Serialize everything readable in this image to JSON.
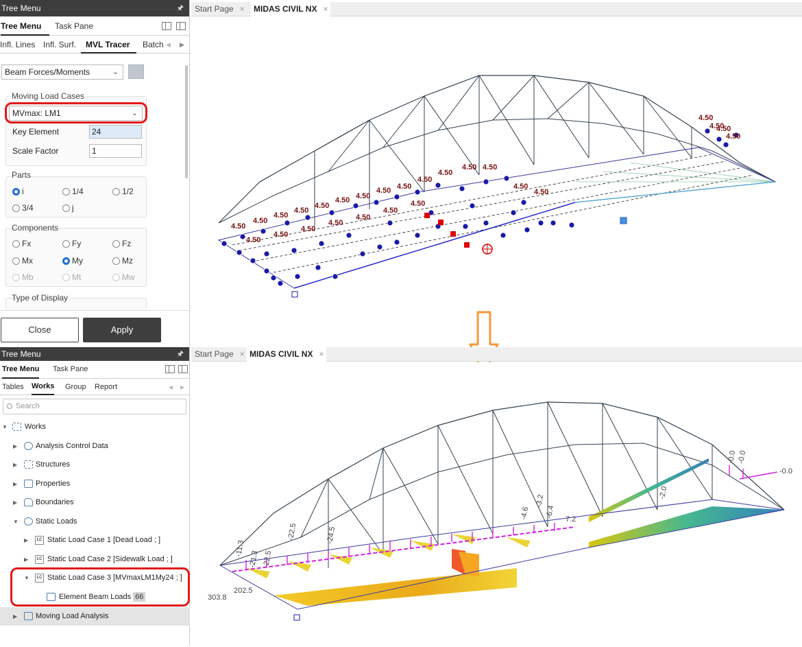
{
  "top_panel": {
    "title": "Tree Menu",
    "pin": "⚓",
    "tabs": [
      "Tree Menu",
      "Task Pane"
    ],
    "subtabs": [
      "Infl. Lines",
      "Infl. Surf.",
      "MVL Tracer",
      "Batch"
    ],
    "result_type": "Beam Forces/Moments",
    "moving_load_cases": {
      "title": "Moving Load Cases",
      "selected": "MVmax: LM1",
      "key_element_label": "Key Element",
      "key_element_value": "24",
      "scale_factor_label": "Scale Factor",
      "scale_factor_value": "1"
    },
    "parts": {
      "title": "Parts",
      "options": [
        "i",
        "1/4",
        "1/2",
        "3/4",
        "j"
      ],
      "selected": "i"
    },
    "components": {
      "title": "Components",
      "options": [
        "Fx",
        "Fy",
        "Fz",
        "Mx",
        "My",
        "Mz",
        "Mb",
        "Mt",
        "Mw"
      ],
      "selected": "My"
    },
    "type_of_display": "Type of Display",
    "close_label": "Close",
    "apply_label": "Apply"
  },
  "bottom_panel": {
    "title": "Tree Menu",
    "tabs": [
      "Tree Menu",
      "Task Pane"
    ],
    "subtabs": [
      "Tables",
      "Works",
      "Group",
      "Report"
    ],
    "search_placeholder": "Search",
    "tree": {
      "root": "Works",
      "items": [
        "Analysis Control Data",
        "Structures",
        "Properties",
        "Boundaries",
        "Static Loads"
      ],
      "static_loads": [
        "Static Load Case 1 [Dead Load ; ]",
        "Static Load Case 2 [Sidewalk Load ; ]",
        "Static Load Case 3 [MVmaxLM1My24 ; ]"
      ],
      "element_beam_loads": "Element Beam Loads",
      "element_beam_loads_count": "66",
      "moving_load_analysis": "Moving Load Analysis",
      "lc_icon": "LC"
    }
  },
  "doc_tabs": {
    "start_page": "Start Page",
    "midas": "MIDAS CIVIL NX",
    "close": "×"
  },
  "top_view_labels": {
    "right_cluster": [
      "4.50",
      "4.50",
      "4.50",
      "4.50"
    ],
    "repeated": "4.50"
  },
  "bottom_view_labels": [
    "303.8",
    "202.5",
    "-11.3",
    "-21.3",
    "-22.5",
    "-22.5",
    "-2.0",
    "-24.5",
    "-0.0",
    "-0.0",
    "-0.0",
    "-4.6",
    "-6.4",
    "7.2",
    "-3.2"
  ],
  "colors": {
    "accent_red": "#e31919",
    "arrow_orange": "#f39a3c",
    "node_blue": "#1a1aa8",
    "label_dark_red": "#7a1212",
    "load_magenta": "#d21fe0"
  }
}
